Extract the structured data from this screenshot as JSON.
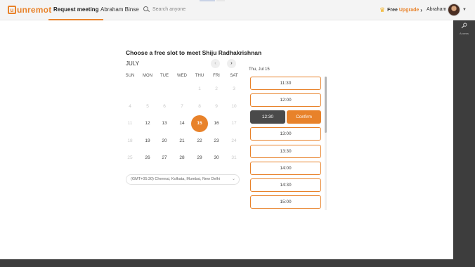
{
  "header": {
    "logo_mark": "u",
    "logo_text": "unremot",
    "tabs": [
      {
        "label": "Request meeting",
        "active": true
      },
      {
        "label": "Abraham Binse",
        "active": false
      }
    ],
    "search_placeholder": "Search anyone",
    "upgrade_free": "Free",
    "upgrade_link": "Upgrade",
    "user_name": "Abraham"
  },
  "sidebar_right": {
    "access_label": "Access"
  },
  "scheduler": {
    "title": "Choose a free slot to meet Shiju Radhakrishnan",
    "month": "JULY",
    "weekdays": [
      "SUN",
      "MON",
      "TUE",
      "WED",
      "THU",
      "FRI",
      "SAT"
    ],
    "weeks": [
      [
        "",
        "",
        "",
        "",
        "1",
        "2",
        "3"
      ],
      [
        "4",
        "5",
        "6",
        "7",
        "8",
        "9",
        "10"
      ],
      [
        "11",
        "12",
        "13",
        "14",
        "15",
        "16",
        "17"
      ],
      [
        "18",
        "19",
        "20",
        "21",
        "22",
        "23",
        "24"
      ],
      [
        "25",
        "26",
        "27",
        "28",
        "29",
        "30",
        "31"
      ]
    ],
    "enabled_days": [
      "12",
      "13",
      "14",
      "16",
      "19",
      "20",
      "21",
      "22",
      "23",
      "26",
      "27",
      "28",
      "29",
      "30"
    ],
    "selected_day": "15",
    "timezone": "(GMT+05:30) Chennai, Kolkata, Mumbai, New Delhi",
    "slot_date": "Thu, Jul 15",
    "slots": [
      "11:30",
      "12:00",
      "12:30",
      "13:00",
      "13:30",
      "14:00",
      "14:30",
      "15:00"
    ],
    "selected_slot": "12:30",
    "confirm_label": "Confirm"
  },
  "colors": {
    "accent": "#e8822a",
    "dark": "#3d3d3d",
    "selected_slot": "#4a4a4a"
  }
}
